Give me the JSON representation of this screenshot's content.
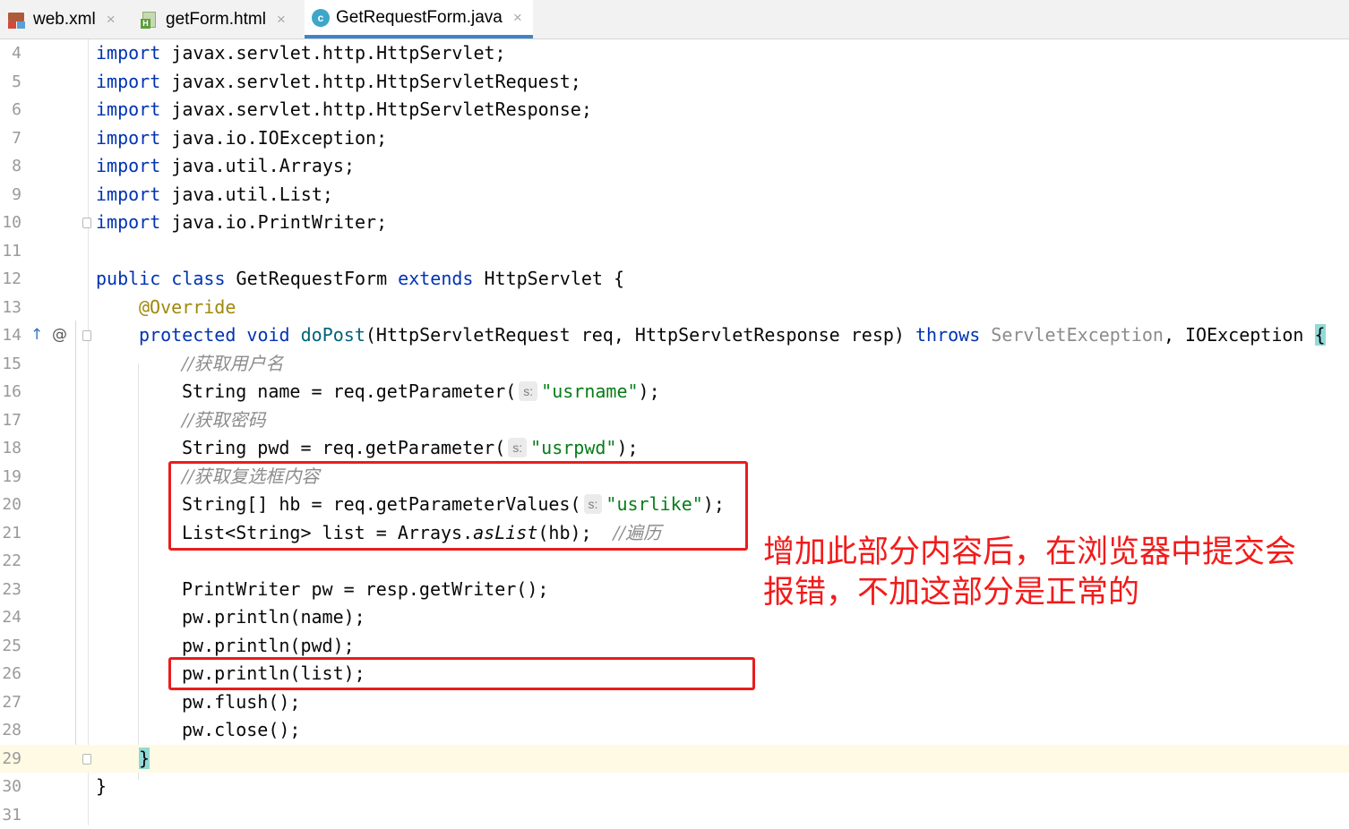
{
  "tabs": [
    {
      "label": "web.xml",
      "icon": "xml-file-icon"
    },
    {
      "label": "getForm.html",
      "icon": "html-file-icon"
    },
    {
      "label": "GetRequestForm.java",
      "icon": "java-class-icon",
      "active": true
    }
  ],
  "close_glyph": "×",
  "gutter_icons": {
    "override_marker": "↑",
    "annotation_marker": "@"
  },
  "line_numbers": [
    "4",
    "5",
    "6",
    "7",
    "8",
    "9",
    "10",
    "11",
    "12",
    "13",
    "14",
    "15",
    "16",
    "17",
    "18",
    "19",
    "20",
    "21",
    "22",
    "23",
    "24",
    "25",
    "26",
    "27",
    "28",
    "29",
    "30",
    "31"
  ],
  "current_line": "29",
  "code": {
    "l4": {
      "kw": "import",
      "rest": " javax.servlet.http.HttpServlet;"
    },
    "l5": {
      "kw": "import",
      "rest": " javax.servlet.http.HttpServletRequest;"
    },
    "l6": {
      "kw": "import",
      "rest": " javax.servlet.http.HttpServletResponse;"
    },
    "l7": {
      "kw": "import",
      "rest": " java.io.IOException;"
    },
    "l8": {
      "kw": "import",
      "rest": " java.util.Arrays;"
    },
    "l9": {
      "kw": "import",
      "rest": " java.util.List;"
    },
    "l10": {
      "kw": "import",
      "rest": " java.io.PrintWriter;"
    },
    "l12": {
      "kw1": "public",
      "kw2": "class",
      "name": " GetRequestForm ",
      "kw3": "extends",
      "rest": " HttpServlet {"
    },
    "l13": {
      "ann": "@Override"
    },
    "l14": {
      "kw1": "protected",
      "kw2": "void",
      "fn": "doPost",
      "params": "(HttpServletRequest req, HttpServletResponse resp) ",
      "kw3": "throws",
      "ex1": "ServletException",
      "ex2": ", IOException ",
      "brace": "{"
    },
    "l15": {
      "cmt": "//获取用户名"
    },
    "l16": {
      "pre": "String name = req.getParameter(",
      "hint": "s:",
      "str": "\"usrname\"",
      "post": ");"
    },
    "l17": {
      "cmt": "//获取密码"
    },
    "l18": {
      "pre": "String pwd = req.getParameter(",
      "hint": "s:",
      "str": "\"usrpwd\"",
      "post": ");"
    },
    "l19": {
      "cmt": "//获取复选框内容"
    },
    "l20": {
      "pre": "String[] hb = req.getParameterValues(",
      "hint": "s:",
      "str": "\"usrlike\"",
      "post": ");"
    },
    "l21": {
      "pre": "List<String> list = Arrays.",
      "it": "asList",
      "post": "(hb);  ",
      "cmt": "//遍历"
    },
    "l23": {
      "text": "PrintWriter pw = resp.getWriter();"
    },
    "l24": {
      "text": "pw.println(name);"
    },
    "l25": {
      "text": "pw.println(pwd);"
    },
    "l26": {
      "text": "pw.println(list);"
    },
    "l27": {
      "text": "pw.flush();"
    },
    "l28": {
      "text": "pw.close();"
    },
    "l29": {
      "text": "}"
    },
    "l30": {
      "text": "}"
    }
  },
  "annotation": {
    "line1": "增加此部分内容后，在浏览器中提交会",
    "line2": "报错，不加这部分是正常的",
    "color": "#f21b1b"
  },
  "colors": {
    "keyword": "#0033b3",
    "string": "#067d17",
    "comment": "#8c8c8c",
    "annotation": "#9e880d",
    "highlight_box": "#e81d1d"
  }
}
